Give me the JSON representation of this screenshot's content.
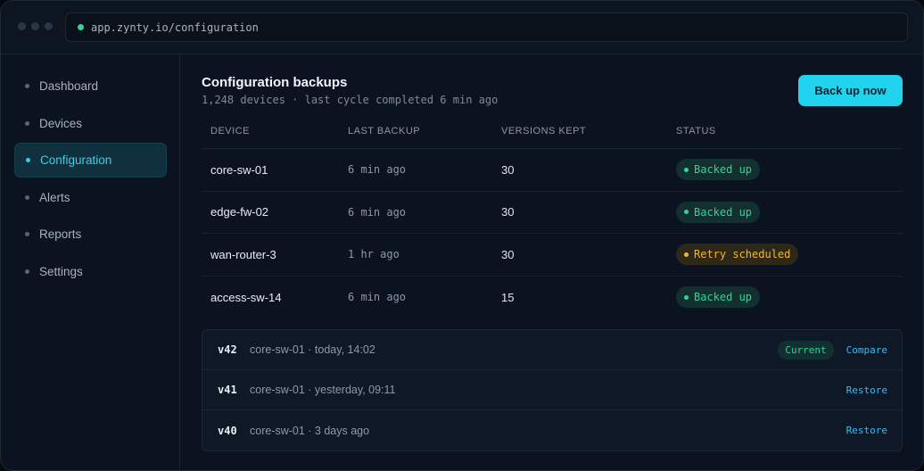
{
  "browser": {
    "url": "app.zynty.io/configuration"
  },
  "sidebar": {
    "items": [
      {
        "label": "Dashboard",
        "active": false
      },
      {
        "label": "Devices",
        "active": false
      },
      {
        "label": "Configuration",
        "active": true
      },
      {
        "label": "Alerts",
        "active": false
      },
      {
        "label": "Reports",
        "active": false
      },
      {
        "label": "Settings",
        "active": false
      }
    ]
  },
  "header": {
    "title": "Configuration backups",
    "subtitle": "1,248 devices · last cycle completed 6 min ago",
    "primary_button": "Back up now"
  },
  "table": {
    "columns": [
      "DEVICE",
      "LAST BACKUP",
      "VERSIONS KEPT",
      "STATUS"
    ],
    "rows": [
      {
        "device": "core-sw-01",
        "last_backup": "6 min ago",
        "versions": "30",
        "status": "Backed up",
        "status_kind": "ok"
      },
      {
        "device": "edge-fw-02",
        "last_backup": "6 min ago",
        "versions": "30",
        "status": "Backed up",
        "status_kind": "ok"
      },
      {
        "device": "wan-router-3",
        "last_backup": "1 hr ago",
        "versions": "30",
        "status": "Retry scheduled",
        "status_kind": "warn"
      },
      {
        "device": "access-sw-14",
        "last_backup": "6 min ago",
        "versions": "15",
        "status": "Backed up",
        "status_kind": "ok"
      }
    ]
  },
  "versions": [
    {
      "tag": "v42",
      "meta": "core-sw-01 · today, 14:02",
      "badge": "Current",
      "action": "Compare"
    },
    {
      "tag": "v41",
      "meta": "core-sw-01 · yesterday, 09:11",
      "action": "Restore"
    },
    {
      "tag": "v40",
      "meta": "core-sw-01 · 3 days ago",
      "action": "Restore"
    }
  ],
  "colors": {
    "accent": "#22d3ee",
    "ok": "#34d399",
    "warn": "#f5b72f",
    "background": "#0b1320"
  }
}
